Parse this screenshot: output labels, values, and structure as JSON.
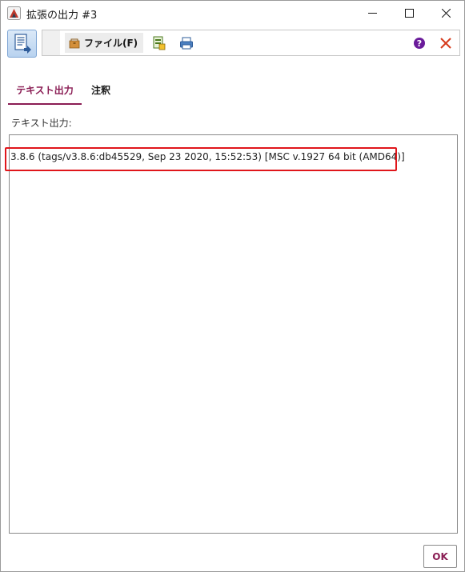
{
  "window": {
    "title": "拡張の出力 #3"
  },
  "toolbar": {
    "file_menu_label": "ファイル(F)"
  },
  "tabs": [
    {
      "label": "テキスト出力",
      "active": true
    },
    {
      "label": "注釈",
      "active": false
    }
  ],
  "output": {
    "label": "テキスト出力:",
    "text": "3.8.6 (tags/v3.8.6:db45529, Sep 23 2020, 15:52:53) [MSC v.1927 64 bit (AMD64)]"
  },
  "footer": {
    "ok_label": "OK"
  },
  "colors": {
    "accent": "#8a1d54",
    "highlight": "#e0161b",
    "close_icon": "#d63a1c",
    "help_icon": "#6a1b9a"
  },
  "icons": [
    "app-icon",
    "minimize-icon",
    "maximize-icon",
    "close-window-icon",
    "output-panel-icon",
    "file-menu-icon",
    "export-icon",
    "print-icon",
    "help-icon",
    "close-panel-icon"
  ]
}
